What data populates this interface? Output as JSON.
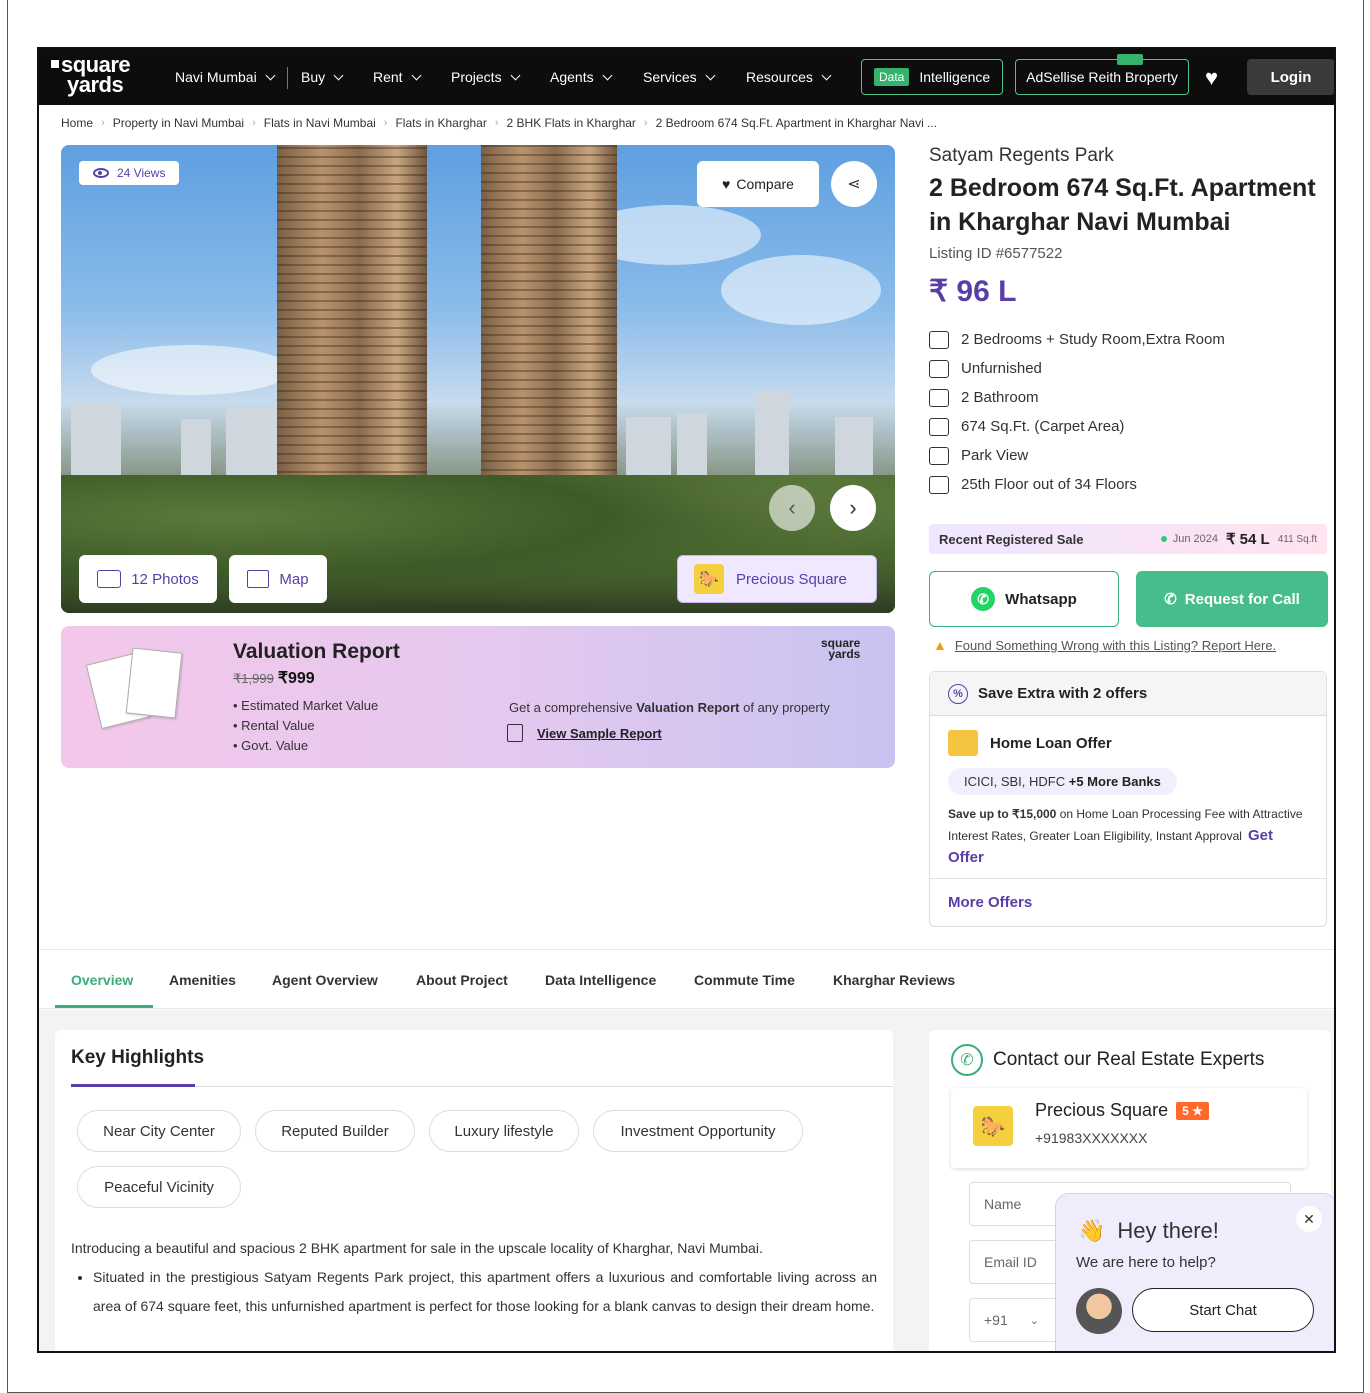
{
  "header": {
    "logo_line1": "square",
    "logo_line2": "yards",
    "city": "Navi Mumbai",
    "nav": [
      "Buy",
      "Rent",
      "Projects",
      "Agents",
      "Services",
      "Resources"
    ],
    "data_tag": "Data",
    "data_label": "Intelligence",
    "sell_label": "AdSellise Reith Broperty",
    "login_label": "Login"
  },
  "breadcrumb": [
    "Home",
    "Property in Navi Mumbai",
    "Flats in Navi Mumbai",
    "Flats in Kharghar",
    "2 BHK Flats in Kharghar",
    "2 Bedroom 674 Sq.Ft. Apartment in Kharghar Navi ..."
  ],
  "gallery": {
    "views": "24 Views",
    "compare_label": "Compare",
    "photos_label": "12 Photos",
    "map_label": "Map",
    "agent_label": "Precious Square"
  },
  "valuation": {
    "title": "Valuation Report",
    "old_price": "₹1,999",
    "price": "₹999",
    "items": [
      "Estimated Market Value",
      "Rental Value",
      "Govt. Value"
    ],
    "logo_l1": "square",
    "logo_l2": "yards",
    "desc_pre": "Get a comprehensive",
    "desc_bold": "Valuation Report",
    "desc_post": "of any property",
    "link": "View Sample Report"
  },
  "listing": {
    "project": "Satyam Regents Park",
    "title": "2 Bedroom 674 Sq.Ft. Apartment in Kharghar Navi Mumbai",
    "listing_id": "Listing ID #6577522",
    "price": "₹ 96 L",
    "features": [
      {
        "icon": "bed-icon",
        "text": "2 Bedrooms + Study Room,Extra Room"
      },
      {
        "icon": "sofa-icon",
        "text": "Unfurnished"
      },
      {
        "icon": "bathtub-icon",
        "text": "2 Bathroom"
      },
      {
        "icon": "area-icon",
        "text": "674 Sq.Ft. (Carpet Area)"
      },
      {
        "icon": "park-icon",
        "text": "Park View"
      },
      {
        "icon": "stairs-icon",
        "text": "25th Floor out of 34 Floors"
      }
    ]
  },
  "recent_sale": {
    "label": "Recent Registered Sale",
    "date": "Jun 2024",
    "price": "₹ 54 L",
    "area": "411 Sq.ft"
  },
  "actions": {
    "whatsapp": "Whatsapp",
    "call": "Request for Call",
    "report": "Found Something Wrong with this Listing? Report Here."
  },
  "offers": {
    "title": "Save Extra with 2 offers",
    "home_loan": "Home Loan Offer",
    "banks": "ICICI, SBI, HDFC",
    "banks_more": "+5 More Banks",
    "save_bold": "Save up to ₹15,000",
    "save_text": "on Home Loan Processing Fee with Attractive Interest Rates, Greater Loan Eligibility, Instant Approval",
    "get_offer": "Get Offer",
    "more": "More Offers"
  },
  "tabs": [
    "Overview",
    "Amenities",
    "Agent Overview",
    "About Project",
    "Data Intelligence",
    "Commute Time",
    "Kharghar Reviews"
  ],
  "highlights": {
    "title": "Key Highlights",
    "chips": [
      "Near City Center",
      "Reputed Builder",
      "Luxury lifestyle",
      "Investment Opportunity",
      "Peaceful Vicinity"
    ],
    "intro": "Introducing a beautiful and spacious 2 BHK apartment for sale in the upscale locality of Kharghar, Navi Mumbai.",
    "bullet": "Situated in the prestigious Satyam Regents Park project, this apartment offers a luxurious and comfortable living across an area of 674 square feet, this unfurnished apartment is perfect for those looking for a blank canvas to design their dream home."
  },
  "contact": {
    "title": "Contact our Real Estate Experts",
    "agent": "Precious Square",
    "rating": "5 ★",
    "phone": "+91983XXXXXXX",
    "name_ph": "Name",
    "email_ph": "Email ID",
    "code": "+91"
  },
  "chat": {
    "greeting": "Hey there!",
    "sub": "We are here to help?",
    "start": "Start Chat"
  }
}
